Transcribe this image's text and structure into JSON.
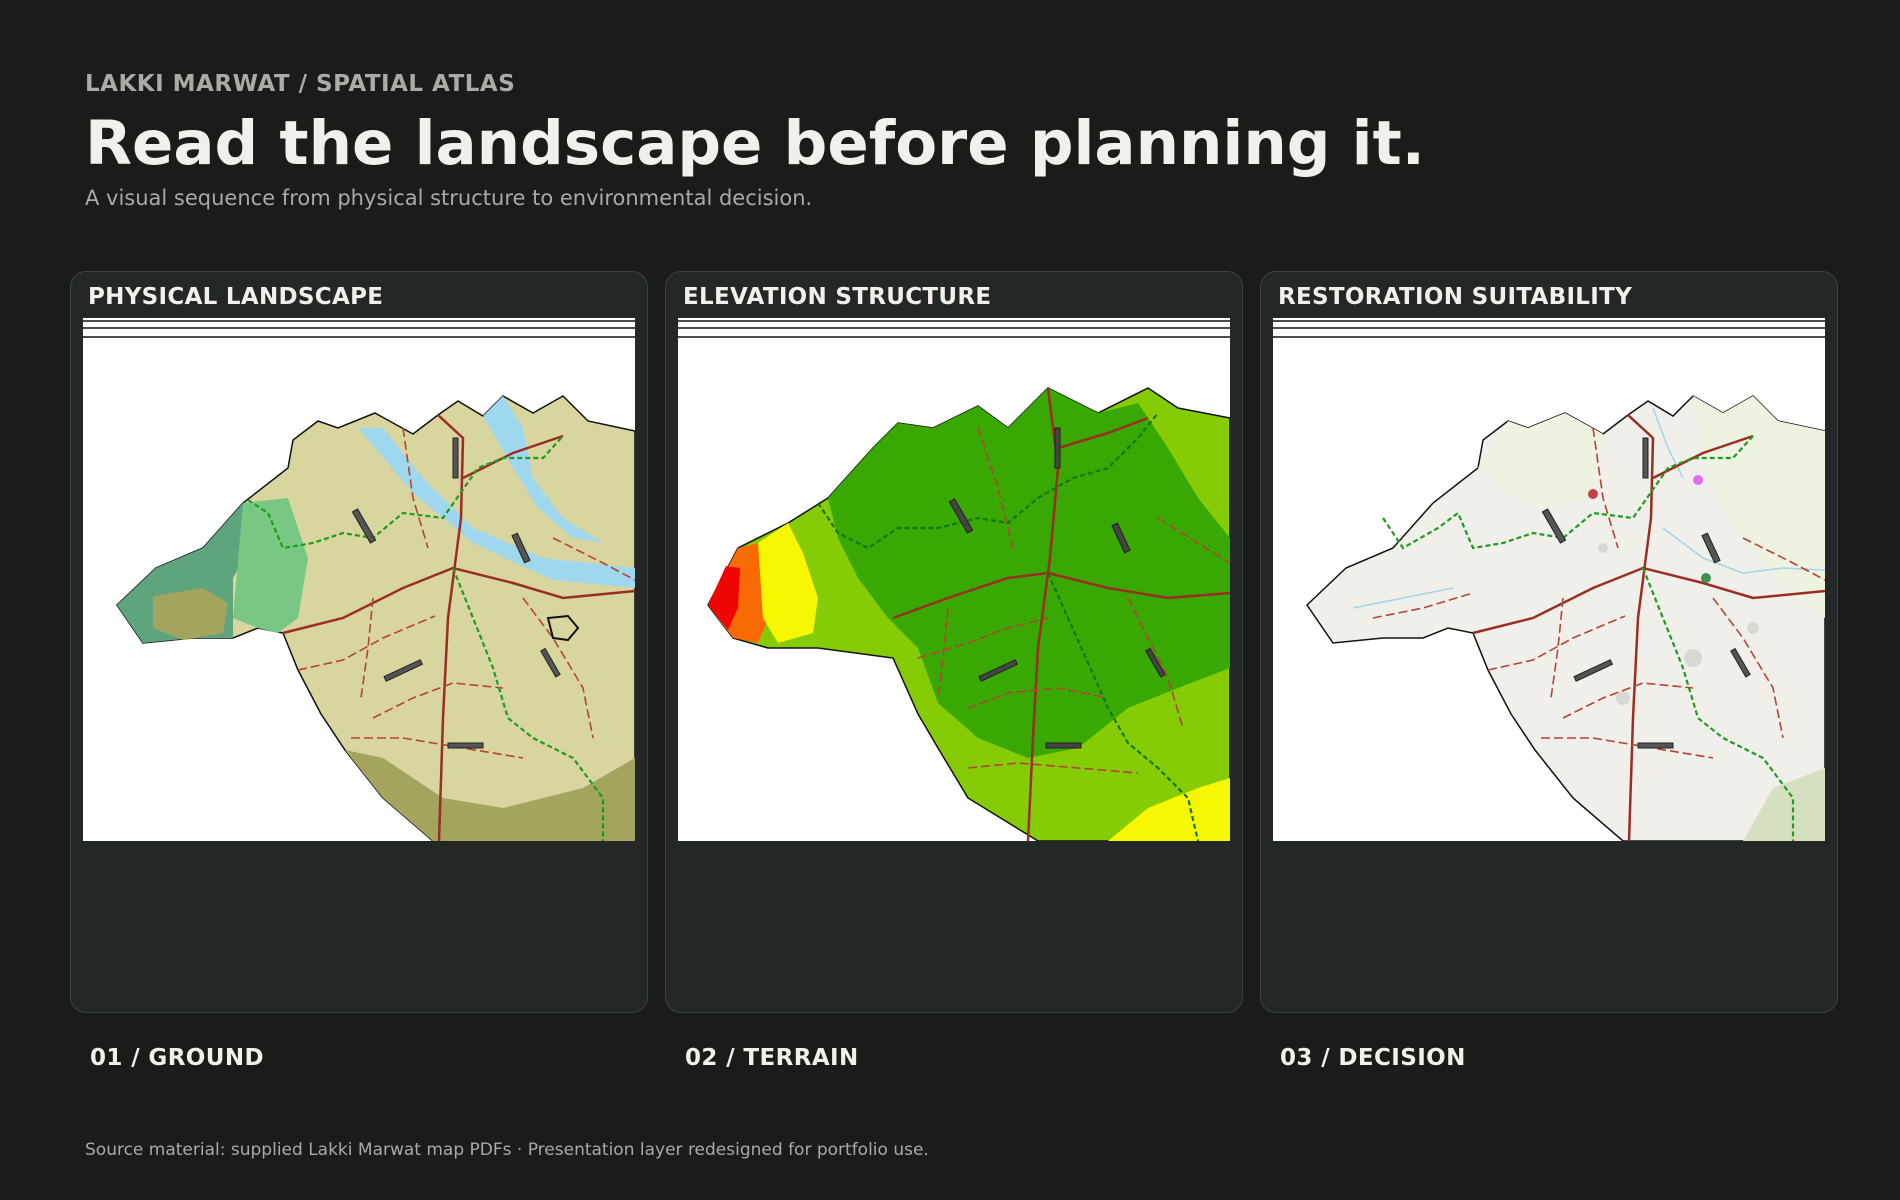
{
  "header": {
    "eyebrow": "LAKKI MARWAT / SPATIAL ATLAS",
    "title": "Read the landscape before planning it.",
    "subtitle": "A visual sequence from physical structure to environmental decision."
  },
  "panels": [
    {
      "title": "PHYSICAL LANDSCAPE",
      "step": "01 / GROUND"
    },
    {
      "title": "ELEVATION STRUCTURE",
      "step": "02 / TERRAIN"
    },
    {
      "title": "RESTORATION SUITABILITY",
      "step": "03 / DECISION"
    }
  ],
  "footer": {
    "source": "Source material: supplied Lakki Marwat map PDFs · Presentation layer redesigned for portfolio use."
  },
  "colors": {
    "background": "#1a1c1a",
    "card": "#232826",
    "road": "#9a2e22",
    "boundary": "#1f9b1f",
    "river": "#9fd8ee"
  }
}
